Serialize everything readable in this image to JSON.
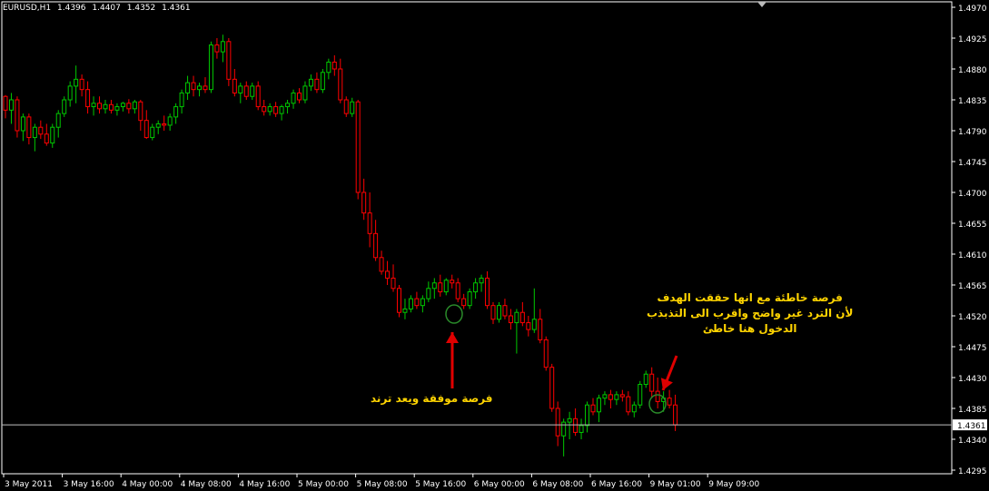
{
  "header": {
    "symbol": "EURUSD,H1",
    "open": "1.4396",
    "high": "1.4407",
    "low": "1.4352",
    "close": "1.4361"
  },
  "annotations": {
    "good_trade": "فرصة موفقة ويعد ترند",
    "bad_trade_lines": [
      "فرصة خاطئة مع انها حققت الهدف",
      "لأن الترد غير واضح واقرب الى التذبذب",
      "الدخول هنا خاطئ"
    ]
  },
  "colors": {
    "background": "#000000",
    "bull": "#00c800",
    "bear": "#ff0000",
    "axis": "#ffffff",
    "annotation_text": "#ffd400",
    "arrow": "#e00000",
    "current_price_line": "#c0c0c0"
  },
  "chart_data": {
    "type": "candlestick",
    "title": "EURUSD,H1",
    "ylim": [
      1.4295,
      1.497
    ],
    "y_ticks": [
      "1.4970",
      "1.4925",
      "1.4880",
      "1.4835",
      "1.4790",
      "1.4745",
      "1.4700",
      "1.4655",
      "1.4610",
      "1.4565",
      "1.4520",
      "1.4475",
      "1.4430",
      "1.4385",
      "1.4340",
      "1.4295"
    ],
    "current_price": "1.4361",
    "x_tick_labels": [
      "3 May 2011",
      "3 May 16:00",
      "4 May 00:00",
      "4 May 08:00",
      "4 May 16:00",
      "5 May 00:00",
      "5 May 08:00",
      "5 May 16:00",
      "6 May 00:00",
      "6 May 08:00",
      "6 May 16:00",
      "9 May 01:00",
      "9 May 09:00"
    ],
    "candles": [
      [
        1.484,
        1.4842,
        1.4808,
        1.482
      ],
      [
        1.482,
        1.4845,
        1.48,
        1.4835
      ],
      [
        1.4835,
        1.484,
        1.478,
        1.479
      ],
      [
        1.479,
        1.4815,
        1.4775,
        1.481
      ],
      [
        1.481,
        1.4815,
        1.477,
        1.478
      ],
      [
        1.478,
        1.48,
        1.476,
        1.4795
      ],
      [
        1.4795,
        1.4805,
        1.4778,
        1.4785
      ],
      [
        1.4785,
        1.48,
        1.4768,
        1.4772
      ],
      [
        1.4772,
        1.48,
        1.4765,
        1.4795
      ],
      [
        1.4795,
        1.482,
        1.478,
        1.4815
      ],
      [
        1.4815,
        1.484,
        1.481,
        1.4835
      ],
      [
        1.4835,
        1.4862,
        1.4825,
        1.4855
      ],
      [
        1.4855,
        1.4885,
        1.483,
        1.4865
      ],
      [
        1.4865,
        1.4872,
        1.484,
        1.485
      ],
      [
        1.485,
        1.4862,
        1.4815,
        1.4825
      ],
      [
        1.4825,
        1.484,
        1.4812,
        1.483
      ],
      [
        1.483,
        1.484,
        1.4815,
        1.4822
      ],
      [
        1.4822,
        1.4835,
        1.4815,
        1.4828
      ],
      [
        1.4828,
        1.4835,
        1.4815,
        1.482
      ],
      [
        1.482,
        1.483,
        1.4812,
        1.4825
      ],
      [
        1.4825,
        1.4832,
        1.4818,
        1.483
      ],
      [
        1.483,
        1.4836,
        1.4815,
        1.4822
      ],
      [
        1.4822,
        1.4835,
        1.4815,
        1.4832
      ],
      [
        1.4832,
        1.4835,
        1.479,
        1.4805
      ],
      [
        1.4805,
        1.482,
        1.4778,
        1.478
      ],
      [
        1.478,
        1.48,
        1.4776,
        1.4795
      ],
      [
        1.4795,
        1.4805,
        1.4785,
        1.48
      ],
      [
        1.48,
        1.4812,
        1.479,
        1.4798
      ],
      [
        1.4798,
        1.4815,
        1.479,
        1.481
      ],
      [
        1.481,
        1.483,
        1.48,
        1.4825
      ],
      [
        1.4825,
        1.485,
        1.4815,
        1.4845
      ],
      [
        1.4845,
        1.487,
        1.4835,
        1.486
      ],
      [
        1.486,
        1.487,
        1.484,
        1.485
      ],
      [
        1.485,
        1.486,
        1.484,
        1.4855
      ],
      [
        1.4855,
        1.4868,
        1.4845,
        1.485
      ],
      [
        1.485,
        1.492,
        1.4845,
        1.4915
      ],
      [
        1.4915,
        1.4925,
        1.4895,
        1.4905
      ],
      [
        1.4905,
        1.493,
        1.489,
        1.492
      ],
      [
        1.492,
        1.4925,
        1.4855,
        1.4865
      ],
      [
        1.4865,
        1.488,
        1.484,
        1.4845
      ],
      [
        1.4845,
        1.486,
        1.483,
        1.4855
      ],
      [
        1.4855,
        1.4862,
        1.4835,
        1.484
      ],
      [
        1.484,
        1.486,
        1.4835,
        1.4855
      ],
      [
        1.4855,
        1.4862,
        1.482,
        1.4825
      ],
      [
        1.4825,
        1.4835,
        1.4812,
        1.4818
      ],
      [
        1.4818,
        1.483,
        1.4812,
        1.4825
      ],
      [
        1.4825,
        1.4832,
        1.481,
        1.4815
      ],
      [
        1.4815,
        1.4828,
        1.4805,
        1.4825
      ],
      [
        1.4825,
        1.4835,
        1.4815,
        1.483
      ],
      [
        1.483,
        1.485,
        1.4822,
        1.4845
      ],
      [
        1.4845,
        1.4852,
        1.483,
        1.4835
      ],
      [
        1.4835,
        1.4862,
        1.483,
        1.4855
      ],
      [
        1.4855,
        1.4872,
        1.4848,
        1.4865
      ],
      [
        1.4865,
        1.4875,
        1.4845,
        1.485
      ],
      [
        1.485,
        1.488,
        1.4845,
        1.4875
      ],
      [
        1.4875,
        1.4895,
        1.4865,
        1.489
      ],
      [
        1.489,
        1.49,
        1.487,
        1.488
      ],
      [
        1.488,
        1.4895,
        1.483,
        1.4835
      ],
      [
        1.4835,
        1.484,
        1.481,
        1.4815
      ],
      [
        1.4815,
        1.4838,
        1.481,
        1.4832
      ],
      [
        1.4832,
        1.4835,
        1.469,
        1.47
      ],
      [
        1.47,
        1.472,
        1.466,
        1.467
      ],
      [
        1.467,
        1.47,
        1.462,
        1.464
      ],
      [
        1.464,
        1.466,
        1.46,
        1.4605
      ],
      [
        1.4605,
        1.4615,
        1.458,
        1.4585
      ],
      [
        1.4585,
        1.46,
        1.4565,
        1.4575
      ],
      [
        1.4575,
        1.4595,
        1.4555,
        1.456
      ],
      [
        1.456,
        1.4565,
        1.4518,
        1.4525
      ],
      [
        1.4525,
        1.4545,
        1.4515,
        1.453
      ],
      [
        1.453,
        1.455,
        1.4525,
        1.4545
      ],
      [
        1.4545,
        1.4555,
        1.453,
        1.4535
      ],
      [
        1.4535,
        1.455,
        1.4525,
        1.4545
      ],
      [
        1.4545,
        1.457,
        1.454,
        1.456
      ],
      [
        1.456,
        1.4575,
        1.4545,
        1.4568
      ],
      [
        1.4568,
        1.458,
        1.4548,
        1.4555
      ],
      [
        1.4555,
        1.4575,
        1.455,
        1.4572
      ],
      [
        1.4572,
        1.458,
        1.456,
        1.4568
      ],
      [
        1.4568,
        1.4575,
        1.454,
        1.4545
      ],
      [
        1.4545,
        1.4552,
        1.453,
        1.4535
      ],
      [
        1.4535,
        1.456,
        1.453,
        1.4555
      ],
      [
        1.4555,
        1.4575,
        1.4545,
        1.4568
      ],
      [
        1.4568,
        1.458,
        1.4555,
        1.4575
      ],
      [
        1.4575,
        1.4585,
        1.453,
        1.4535
      ],
      [
        1.4535,
        1.454,
        1.4508,
        1.4515
      ],
      [
        1.4515,
        1.454,
        1.451,
        1.4535
      ],
      [
        1.4535,
        1.4545,
        1.4515,
        1.452
      ],
      [
        1.452,
        1.453,
        1.45,
        1.451
      ],
      [
        1.451,
        1.453,
        1.4465,
        1.4525
      ],
      [
        1.4525,
        1.454,
        1.4505,
        1.451
      ],
      [
        1.451,
        1.452,
        1.449,
        1.45
      ],
      [
        1.45,
        1.456,
        1.4495,
        1.4515
      ],
      [
        1.4515,
        1.453,
        1.448,
        1.4485
      ],
      [
        1.4485,
        1.449,
        1.444,
        1.4445
      ],
      [
        1.4445,
        1.445,
        1.438,
        1.4385
      ],
      [
        1.4385,
        1.4395,
        1.433,
        1.4345
      ],
      [
        1.4345,
        1.437,
        1.4315,
        1.4365
      ],
      [
        1.4365,
        1.438,
        1.434,
        1.437
      ],
      [
        1.437,
        1.4385,
        1.4345,
        1.435
      ],
      [
        1.435,
        1.437,
        1.434,
        1.436
      ],
      [
        1.436,
        1.4395,
        1.435,
        1.439
      ],
      [
        1.439,
        1.44,
        1.4375,
        1.438
      ],
      [
        1.438,
        1.4405,
        1.4365,
        1.44
      ],
      [
        1.44,
        1.441,
        1.439,
        1.4405
      ],
      [
        1.4405,
        1.4412,
        1.4385,
        1.4398
      ],
      [
        1.4398,
        1.441,
        1.439,
        1.4405
      ],
      [
        1.4405,
        1.4412,
        1.4395,
        1.4402
      ],
      [
        1.4402,
        1.441,
        1.4375,
        1.438
      ],
      [
        1.438,
        1.4395,
        1.4372,
        1.439
      ],
      [
        1.439,
        1.4425,
        1.4385,
        1.442
      ],
      [
        1.442,
        1.444,
        1.4415,
        1.4435
      ],
      [
        1.4435,
        1.4445,
        1.44,
        1.441
      ],
      [
        1.441,
        1.443,
        1.4385,
        1.4395
      ],
      [
        1.4395,
        1.441,
        1.438,
        1.44
      ],
      [
        1.44,
        1.4412,
        1.4385,
        1.439
      ],
      [
        1.439,
        1.4405,
        1.4352,
        1.4361
      ]
    ]
  }
}
